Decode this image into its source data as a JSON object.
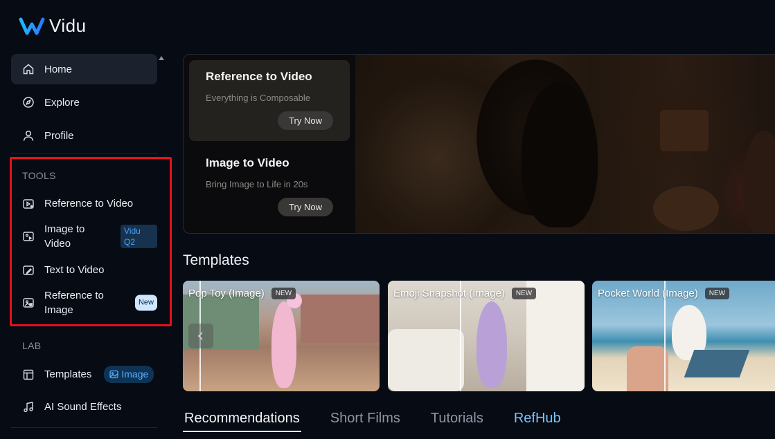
{
  "app": {
    "name": "Vidu"
  },
  "sidebar": {
    "nav": [
      {
        "label": "Home",
        "icon": "home-icon",
        "active": true
      },
      {
        "label": "Explore",
        "icon": "compass-icon"
      },
      {
        "label": "Profile",
        "icon": "user-icon"
      }
    ],
    "tools_label": "TOOLS",
    "tools": [
      {
        "label": "Reference to Video",
        "icon": "reference-video-icon"
      },
      {
        "label": "Image to Video",
        "icon": "image-video-icon",
        "badge": "Vidu Q2"
      },
      {
        "label": "Text to Video",
        "icon": "text-video-icon"
      },
      {
        "label": "Reference to Image",
        "icon": "reference-image-icon",
        "badge": "New"
      }
    ],
    "lab_label": "LAB",
    "lab": [
      {
        "label": "Templates",
        "icon": "layout-icon",
        "badge": "Image"
      },
      {
        "label": "AI Sound Effects",
        "icon": "music-note-icon"
      }
    ]
  },
  "hero": {
    "panels": [
      {
        "title": "Reference to Video",
        "subtitle": "Everything is Composable",
        "button": "Try Now"
      },
      {
        "title": "Image to Video",
        "subtitle": "Bring Image to Life in 20s",
        "button": "Try Now"
      }
    ]
  },
  "templates": {
    "title": "Templates",
    "cards": [
      {
        "title": "Pop Toy (Image)",
        "badge": "NEW"
      },
      {
        "title": "Emoji Snapshot (Image)",
        "badge": "NEW"
      },
      {
        "title": "Pocket World (Image)",
        "badge": "NEW"
      }
    ]
  },
  "tabs": [
    {
      "label": "Recommendations",
      "active": true
    },
    {
      "label": "Short Films"
    },
    {
      "label": "Tutorials"
    },
    {
      "label": "RefHub"
    }
  ],
  "colors": {
    "highlight": "#e8101a",
    "accent": "#4aa3ff",
    "background": "#060b14"
  }
}
